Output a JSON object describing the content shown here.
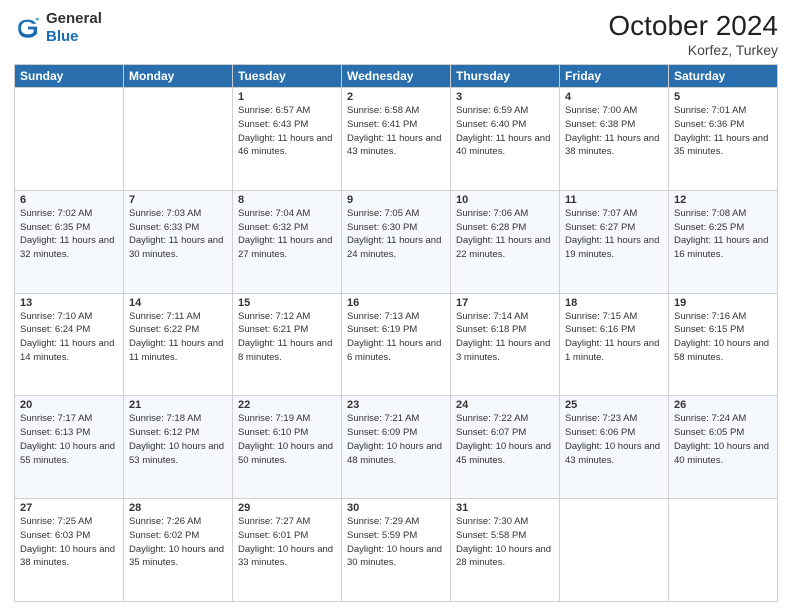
{
  "header": {
    "logo": {
      "general": "General",
      "blue": "Blue"
    },
    "title": "October 2024",
    "subtitle": "Korfez, Turkey"
  },
  "weekdays": [
    "Sunday",
    "Monday",
    "Tuesday",
    "Wednesday",
    "Thursday",
    "Friday",
    "Saturday"
  ],
  "weeks": [
    [
      {
        "day": "",
        "sunrise": "",
        "sunset": "",
        "daylight": ""
      },
      {
        "day": "",
        "sunrise": "",
        "sunset": "",
        "daylight": ""
      },
      {
        "day": "1",
        "sunrise": "Sunrise: 6:57 AM",
        "sunset": "Sunset: 6:43 PM",
        "daylight": "Daylight: 11 hours and 46 minutes."
      },
      {
        "day": "2",
        "sunrise": "Sunrise: 6:58 AM",
        "sunset": "Sunset: 6:41 PM",
        "daylight": "Daylight: 11 hours and 43 minutes."
      },
      {
        "day": "3",
        "sunrise": "Sunrise: 6:59 AM",
        "sunset": "Sunset: 6:40 PM",
        "daylight": "Daylight: 11 hours and 40 minutes."
      },
      {
        "day": "4",
        "sunrise": "Sunrise: 7:00 AM",
        "sunset": "Sunset: 6:38 PM",
        "daylight": "Daylight: 11 hours and 38 minutes."
      },
      {
        "day": "5",
        "sunrise": "Sunrise: 7:01 AM",
        "sunset": "Sunset: 6:36 PM",
        "daylight": "Daylight: 11 hours and 35 minutes."
      }
    ],
    [
      {
        "day": "6",
        "sunrise": "Sunrise: 7:02 AM",
        "sunset": "Sunset: 6:35 PM",
        "daylight": "Daylight: 11 hours and 32 minutes."
      },
      {
        "day": "7",
        "sunrise": "Sunrise: 7:03 AM",
        "sunset": "Sunset: 6:33 PM",
        "daylight": "Daylight: 11 hours and 30 minutes."
      },
      {
        "day": "8",
        "sunrise": "Sunrise: 7:04 AM",
        "sunset": "Sunset: 6:32 PM",
        "daylight": "Daylight: 11 hours and 27 minutes."
      },
      {
        "day": "9",
        "sunrise": "Sunrise: 7:05 AM",
        "sunset": "Sunset: 6:30 PM",
        "daylight": "Daylight: 11 hours and 24 minutes."
      },
      {
        "day": "10",
        "sunrise": "Sunrise: 7:06 AM",
        "sunset": "Sunset: 6:28 PM",
        "daylight": "Daylight: 11 hours and 22 minutes."
      },
      {
        "day": "11",
        "sunrise": "Sunrise: 7:07 AM",
        "sunset": "Sunset: 6:27 PM",
        "daylight": "Daylight: 11 hours and 19 minutes."
      },
      {
        "day": "12",
        "sunrise": "Sunrise: 7:08 AM",
        "sunset": "Sunset: 6:25 PM",
        "daylight": "Daylight: 11 hours and 16 minutes."
      }
    ],
    [
      {
        "day": "13",
        "sunrise": "Sunrise: 7:10 AM",
        "sunset": "Sunset: 6:24 PM",
        "daylight": "Daylight: 11 hours and 14 minutes."
      },
      {
        "day": "14",
        "sunrise": "Sunrise: 7:11 AM",
        "sunset": "Sunset: 6:22 PM",
        "daylight": "Daylight: 11 hours and 11 minutes."
      },
      {
        "day": "15",
        "sunrise": "Sunrise: 7:12 AM",
        "sunset": "Sunset: 6:21 PM",
        "daylight": "Daylight: 11 hours and 8 minutes."
      },
      {
        "day": "16",
        "sunrise": "Sunrise: 7:13 AM",
        "sunset": "Sunset: 6:19 PM",
        "daylight": "Daylight: 11 hours and 6 minutes."
      },
      {
        "day": "17",
        "sunrise": "Sunrise: 7:14 AM",
        "sunset": "Sunset: 6:18 PM",
        "daylight": "Daylight: 11 hours and 3 minutes."
      },
      {
        "day": "18",
        "sunrise": "Sunrise: 7:15 AM",
        "sunset": "Sunset: 6:16 PM",
        "daylight": "Daylight: 11 hours and 1 minute."
      },
      {
        "day": "19",
        "sunrise": "Sunrise: 7:16 AM",
        "sunset": "Sunset: 6:15 PM",
        "daylight": "Daylight: 10 hours and 58 minutes."
      }
    ],
    [
      {
        "day": "20",
        "sunrise": "Sunrise: 7:17 AM",
        "sunset": "Sunset: 6:13 PM",
        "daylight": "Daylight: 10 hours and 55 minutes."
      },
      {
        "day": "21",
        "sunrise": "Sunrise: 7:18 AM",
        "sunset": "Sunset: 6:12 PM",
        "daylight": "Daylight: 10 hours and 53 minutes."
      },
      {
        "day": "22",
        "sunrise": "Sunrise: 7:19 AM",
        "sunset": "Sunset: 6:10 PM",
        "daylight": "Daylight: 10 hours and 50 minutes."
      },
      {
        "day": "23",
        "sunrise": "Sunrise: 7:21 AM",
        "sunset": "Sunset: 6:09 PM",
        "daylight": "Daylight: 10 hours and 48 minutes."
      },
      {
        "day": "24",
        "sunrise": "Sunrise: 7:22 AM",
        "sunset": "Sunset: 6:07 PM",
        "daylight": "Daylight: 10 hours and 45 minutes."
      },
      {
        "day": "25",
        "sunrise": "Sunrise: 7:23 AM",
        "sunset": "Sunset: 6:06 PM",
        "daylight": "Daylight: 10 hours and 43 minutes."
      },
      {
        "day": "26",
        "sunrise": "Sunrise: 7:24 AM",
        "sunset": "Sunset: 6:05 PM",
        "daylight": "Daylight: 10 hours and 40 minutes."
      }
    ],
    [
      {
        "day": "27",
        "sunrise": "Sunrise: 7:25 AM",
        "sunset": "Sunset: 6:03 PM",
        "daylight": "Daylight: 10 hours and 38 minutes."
      },
      {
        "day": "28",
        "sunrise": "Sunrise: 7:26 AM",
        "sunset": "Sunset: 6:02 PM",
        "daylight": "Daylight: 10 hours and 35 minutes."
      },
      {
        "day": "29",
        "sunrise": "Sunrise: 7:27 AM",
        "sunset": "Sunset: 6:01 PM",
        "daylight": "Daylight: 10 hours and 33 minutes."
      },
      {
        "day": "30",
        "sunrise": "Sunrise: 7:29 AM",
        "sunset": "Sunset: 5:59 PM",
        "daylight": "Daylight: 10 hours and 30 minutes."
      },
      {
        "day": "31",
        "sunrise": "Sunrise: 7:30 AM",
        "sunset": "Sunset: 5:58 PM",
        "daylight": "Daylight: 10 hours and 28 minutes."
      },
      {
        "day": "",
        "sunrise": "",
        "sunset": "",
        "daylight": ""
      },
      {
        "day": "",
        "sunrise": "",
        "sunset": "",
        "daylight": ""
      }
    ]
  ]
}
